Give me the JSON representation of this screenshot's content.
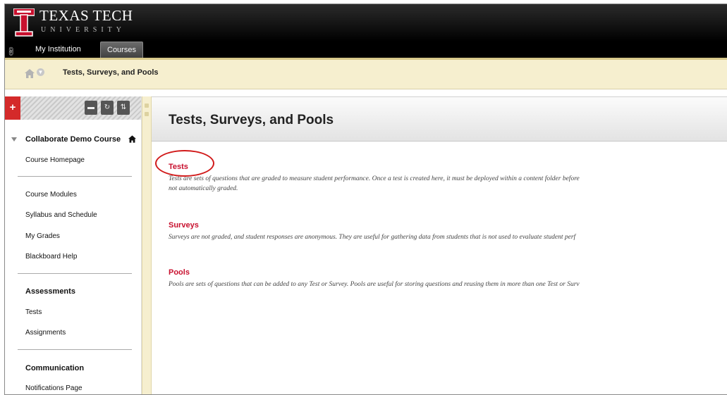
{
  "brand": {
    "title": "TEXAS TECH",
    "subtitle": "UNIVERSITY"
  },
  "tabs": [
    {
      "label": "My Institution"
    },
    {
      "label": "Courses"
    }
  ],
  "breadcrumb": {
    "current": "Tests, Surveys, and Pools"
  },
  "sidebar": {
    "course_name": "Collaborate Demo Course",
    "items": {
      "course_homepage": "Course Homepage",
      "course_modules": "Course Modules",
      "syllabus": "Syllabus and Schedule",
      "my_grades": "My Grades",
      "bb_help": "Blackboard Help",
      "assessments_head": "Assessments",
      "tests": "Tests",
      "assignments": "Assignments",
      "communication_head": "Communication",
      "notifications": "Notifications Page"
    }
  },
  "content": {
    "title": "Tests, Surveys, and Pools",
    "sections": [
      {
        "title": "Tests",
        "desc_line1": "Tests are sets of questions that are graded to measure student performance. Once a test is created here, it must be deployed within a content folder before",
        "desc_line2": "not automatically graded."
      },
      {
        "title": "Surveys",
        "desc_line1": "Surveys are not graded, and student responses are anonymous. They are useful for gathering data from students that is not used to evaluate student perf"
      },
      {
        "title": "Pools",
        "desc_line1": "Pools are sets of questions that can be added to any Test or Survey. Pools are useful for storing questions and reusing them in more than one Test or Surv"
      }
    ]
  },
  "colors": {
    "accent_red": "#c8102e",
    "annotation_circle": "#d11a1a",
    "breadcrumb_bg": "#f6efcf"
  }
}
